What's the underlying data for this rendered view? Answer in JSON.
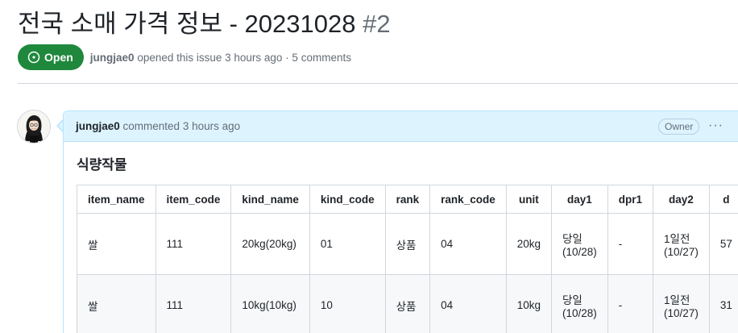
{
  "issue": {
    "title": "전국 소매 가격 정보 - 20231028",
    "number": "#2",
    "status": "Open",
    "author": "jungjae0",
    "meta_rest": "opened this issue 3 hours ago · 5 comments"
  },
  "comment": {
    "author": "jungjae0",
    "action": "commented 3 hours ago",
    "role_badge": "Owner",
    "more_icon": "kebab-horizontal-icon",
    "section_title": "식량작물"
  },
  "table": {
    "headers": [
      "item_name",
      "item_code",
      "kind_name",
      "kind_code",
      "rank",
      "rank_code",
      "unit",
      "day1",
      "dpr1",
      "day2",
      "d"
    ],
    "rows": [
      [
        "쌀",
        "111",
        "20kg(20kg)",
        "01",
        "상품",
        "04",
        "20kg",
        [
          "당일",
          "(10/28)"
        ],
        "-",
        [
          "1일전",
          "(10/27)"
        ],
        "57"
      ],
      [
        "쌀",
        "111",
        "10kg(10kg)",
        "10",
        "상품",
        "04",
        "10kg",
        [
          "당일",
          "(10/28)"
        ],
        "-",
        [
          "1일전",
          "(10/27)"
        ],
        "31"
      ]
    ]
  },
  "colors": {
    "open_badge": "#1f883d",
    "comment_header_bg": "#ddf4ff",
    "comment_border": "#b6e3ff"
  }
}
